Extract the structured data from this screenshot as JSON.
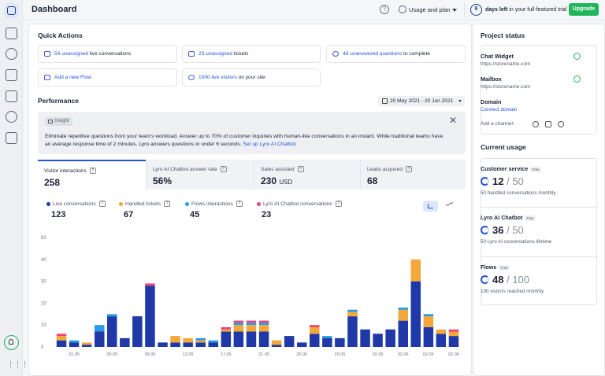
{
  "topbar": {
    "title": "Dashboard",
    "help_icon": "help-circle-icon",
    "plan_label": "Usage and plan",
    "trial_days": "9",
    "trial_bold": "days left",
    "trial_rest": " in your full-featured trial",
    "upgrade_label": "Upgrade"
  },
  "rail": {
    "items": [
      "dashboard-icon",
      "inbox-icon",
      "bot-icon",
      "flows-icon",
      "tickets-icon",
      "contacts-icon",
      "analytics-icon"
    ]
  },
  "quick_actions": {
    "title": "Quick Actions",
    "items": [
      {
        "link": "54 unassigned",
        "rest": " live conversations"
      },
      {
        "link": "23 unassigned",
        "rest": " tickets"
      },
      {
        "link": "48 unanswered questions",
        "rest": " to complete"
      },
      {
        "link": "Add a new Flow",
        "rest": ""
      },
      {
        "link": "1000 live visitors",
        "rest": " on your site"
      }
    ]
  },
  "performance": {
    "title": "Performance",
    "date_range": "20 May 2021 - 20 Jun 2021",
    "insight_tag": "Insight",
    "insight_text": "Eliminate repetitive questions from your team's workload. Answer up to 70% of customer inquiries with human-like conversations in an instant. While traditional teams have an average response time of 2 minutes, Lyro answers questions in under 6 seconds.",
    "insight_link": "Set up Lyro AI Chatbot",
    "tabs": [
      {
        "label": "Visitor interactions",
        "value": "258",
        "unit": ""
      },
      {
        "label": "Lyro AI Chatbot answer rate",
        "value": "56%",
        "unit": ""
      },
      {
        "label": "Sales assisted",
        "value": "230",
        "unit": "USD"
      },
      {
        "label": "Leads acquired",
        "value": "68",
        "unit": ""
      }
    ],
    "legend": [
      {
        "label": "Live conversations",
        "value": "123",
        "color": "#1f3aa8"
      },
      {
        "label": "Handled tickets",
        "value": "67",
        "color": "#f5a83a"
      },
      {
        "label": "Flows interactions",
        "value": "45",
        "color": "#2b9be8"
      },
      {
        "label": "Lyro AI Chatbot conversations",
        "value": "23",
        "color": "#e8457a"
      }
    ]
  },
  "chart_data": {
    "type": "bar",
    "stacked": true,
    "ylim": [
      0,
      50
    ],
    "yticks": [
      "50",
      "40",
      "30",
      "20",
      "10",
      "0"
    ],
    "xticks": [
      "01.05",
      "05.05",
      "09.05",
      "13.05",
      "17.05",
      "21.05",
      "25.05",
      "29.05",
      "02.06",
      "02.06",
      "02.06",
      "02.06"
    ],
    "series": [
      {
        "name": "Live conversations",
        "color": "#1f3aa8",
        "values": [
          3,
          2,
          1,
          7,
          14,
          4,
          14,
          28,
          2,
          2,
          2,
          2,
          2,
          7,
          7,
          7,
          7,
          1,
          5,
          2,
          6,
          4,
          4,
          14,
          8,
          6,
          8,
          12,
          30,
          9,
          6,
          5
        ]
      },
      {
        "name": "Handled tickets",
        "color": "#f5a83a",
        "values": [
          2,
          0,
          1,
          0,
          0,
          0,
          0,
          0,
          0,
          3,
          2,
          1,
          0,
          1,
          3,
          3,
          3,
          2,
          0,
          0,
          3,
          0,
          0,
          2,
          0,
          0,
          0,
          5,
          10,
          5,
          2,
          2
        ]
      },
      {
        "name": "Flows interactions",
        "color": "#2b9be8",
        "values": [
          0,
          1,
          0,
          3,
          1,
          0,
          0,
          0,
          0,
          0,
          0,
          1,
          1,
          0,
          1,
          1,
          1,
          0,
          0,
          0,
          0,
          1,
          0,
          1,
          0,
          0,
          0,
          1,
          0,
          1,
          0,
          0
        ]
      },
      {
        "name": "Lyro AI Chatbot conversations",
        "color": "#e8457a",
        "values": [
          1,
          0,
          0,
          0,
          0,
          0,
          0,
          1,
          0,
          0,
          0,
          0,
          0,
          1,
          1,
          1,
          1,
          0,
          0,
          0,
          1,
          0,
          0,
          0,
          0,
          0,
          0,
          0,
          0,
          0,
          0,
          1
        ]
      }
    ],
    "series_totals_dummy": [],
    "extra": {
      "row_tops": [
        3,
        2,
        1,
        7,
        14,
        4,
        14,
        28,
        2,
        2,
        2,
        2,
        2,
        7,
        7,
        7,
        7,
        1,
        5,
        2,
        6,
        4,
        4,
        14,
        8,
        6,
        8,
        12,
        30,
        9,
        6,
        5
      ]
    }
  },
  "project_status": {
    "title": "Project status",
    "items": [
      {
        "title": "Chat Widget",
        "url": "https://storename.com",
        "ok": true
      },
      {
        "title": "Mailbox",
        "url": "https://storename.com",
        "ok": true
      },
      {
        "title": "Domain",
        "url": "Connect domain",
        "ok": false
      }
    ],
    "channel_label": "Add a channel:"
  },
  "current_usage": {
    "title": "Current usage",
    "items": [
      {
        "title": "Customer service",
        "tag": "Free",
        "used": "12",
        "limit": "/ 50",
        "caption": "50 handled conversations monthly"
      },
      {
        "title": "Lyro AI Chatbot",
        "tag": "Free",
        "used": "36",
        "limit": "/ 50",
        "caption": "50 Lyro AI conversations lifetime"
      },
      {
        "title": "Flows",
        "tag": "Free",
        "used": "48",
        "limit": "/ 100",
        "caption": "100 visitors reached monthly"
      }
    ]
  }
}
